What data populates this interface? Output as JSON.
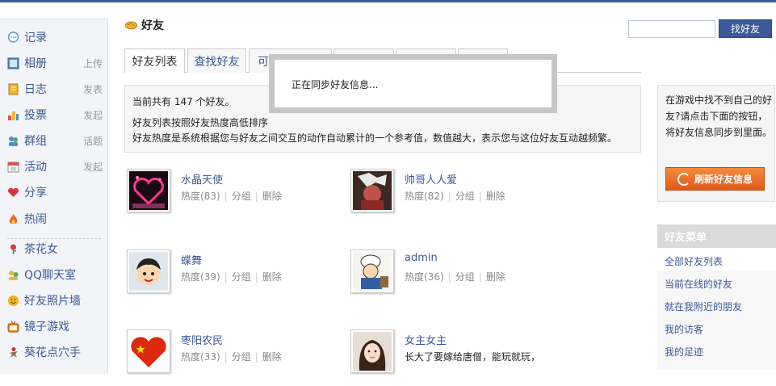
{
  "sidebar": {
    "items": [
      {
        "label": "记录",
        "action": ""
      },
      {
        "label": "相册",
        "action": "上传"
      },
      {
        "label": "日志",
        "action": "发表"
      },
      {
        "label": "投票",
        "action": "发起"
      },
      {
        "label": "群组",
        "action": "话题"
      },
      {
        "label": "活动",
        "action": "发起"
      },
      {
        "label": "分享",
        "action": ""
      },
      {
        "label": "热闹",
        "action": ""
      }
    ],
    "apps": [
      {
        "label": "茶花女"
      },
      {
        "label": "QQ聊天室"
      },
      {
        "label": "好友照片墙"
      },
      {
        "label": "镜子游戏"
      },
      {
        "label": "葵花点穴手"
      }
    ]
  },
  "header": {
    "title": "好友",
    "search_placeholder": "",
    "search_button": "找好友"
  },
  "tabs": [
    {
      "label": "好友列表",
      "active": true
    },
    {
      "label": "查找好友",
      "active": false
    },
    {
      "label": "可",
      "active": false
    },
    {
      "label": "",
      "active": false
    },
    {
      "label": "",
      "active": false
    },
    {
      "label": "",
      "active": false
    }
  ],
  "info": {
    "count_text": "当前共有  147 个好友。",
    "line1": "好友列表按照好友热度高低排序",
    "line2": "好友热度是系统根据您与好友之间交互的动作自动累计的一个参考值，数值越大，表示您与这位好友互动越频繁。"
  },
  "friends": [
    {
      "name": "水晶天使",
      "heat": "热度(83)",
      "group": "分组",
      "delete": "删除"
    },
    {
      "name": "帅哥人人爱",
      "heat": "热度(82)",
      "group": "分组",
      "delete": "删除"
    },
    {
      "name": "蝶舞",
      "heat": "热度(39)",
      "group": "分组",
      "delete": "删除"
    },
    {
      "name": "admin",
      "heat": "热度(36)",
      "group": "分组",
      "delete": "删除"
    },
    {
      "name": "枣阳农民",
      "heat": "热度(33)",
      "group": "分组",
      "delete": "删除"
    },
    {
      "name": "女主女主",
      "heat": "长大了要嫁给唐僧，能玩就玩，",
      "group": "",
      "delete": ""
    }
  ],
  "right_box": {
    "text": "在游戏中找不到自己的好友?请点击下面的按钮，将好友信息同步到里面。",
    "sync_button": "刷新好友信息"
  },
  "friend_menu": {
    "title": "好友菜单",
    "items": [
      "全部好友列表",
      "当前在线的好友",
      "就在我附近的朋友",
      "我的访客",
      "我的足迹"
    ]
  },
  "popup": {
    "text": "正在同步好友信息..."
  },
  "colors": {
    "brand": "#3b5998",
    "sync_button": "#f07030"
  }
}
